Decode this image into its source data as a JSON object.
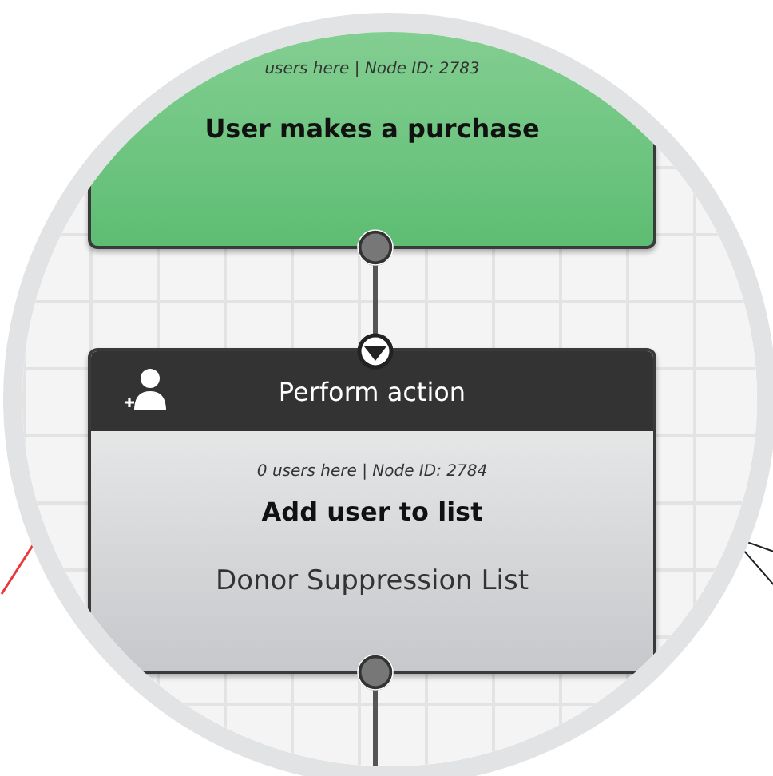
{
  "nodes": [
    {
      "kind": "trigger",
      "meta": "users here | Node ID: 2783",
      "title": "User makes a purchase"
    },
    {
      "kind": "action",
      "header": "Perform action",
      "meta": "0 users here | Node ID: 2784",
      "title": "Add user to list",
      "detail": "Donor Suppression List"
    }
  ]
}
